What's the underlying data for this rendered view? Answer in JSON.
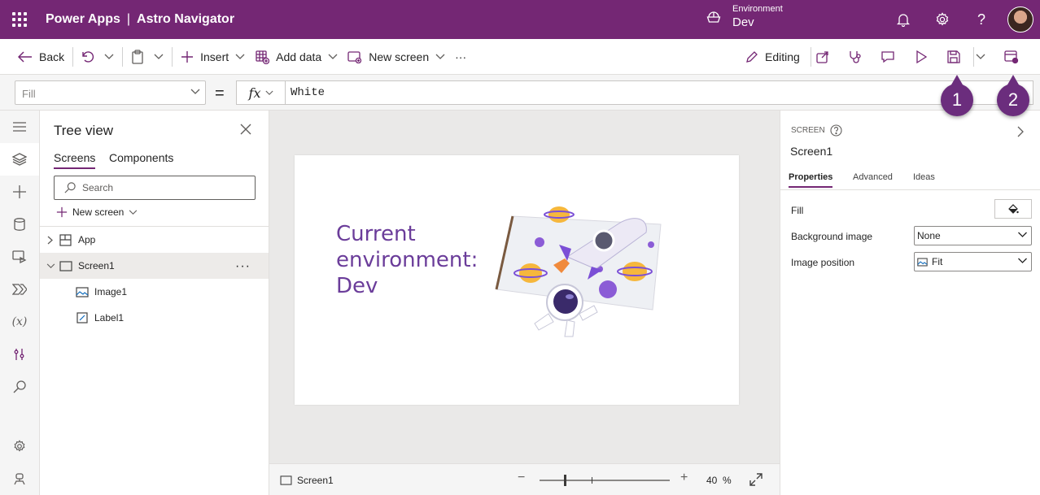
{
  "header": {
    "app_name": "Power Apps",
    "separator": "|",
    "project_name": "Astro Navigator",
    "environment_label": "Environment",
    "environment_value": "Dev",
    "icons": [
      "waffle-icon",
      "environment-icon",
      "bell-icon",
      "gear-icon",
      "help-icon",
      "avatar"
    ]
  },
  "command_bar": {
    "back": "Back",
    "insert": "Insert",
    "add_data": "Add data",
    "new_screen": "New screen",
    "more": "···",
    "editing": "Editing"
  },
  "formula_bar": {
    "property_placeholder": "Fill",
    "equals": "=",
    "fx": "fx",
    "formula": "White"
  },
  "tree_view": {
    "title": "Tree view",
    "tabs": [
      "Screens",
      "Components"
    ],
    "search_placeholder": "Search",
    "new_screen": "New screen",
    "nodes": [
      {
        "label": "App"
      },
      {
        "label": "Screen1"
      },
      {
        "label": "Image1"
      },
      {
        "label": "Label1"
      }
    ],
    "more": "···"
  },
  "canvas": {
    "label_text": [
      "Current",
      "environment:",
      "Dev"
    ],
    "label_color": "#6b3d9a"
  },
  "status_bar": {
    "screen_name": "Screen1",
    "zoom_value": "40",
    "zoom_unit": "%",
    "minus": "−",
    "plus": "+"
  },
  "properties": {
    "type": "SCREEN",
    "name": "Screen1",
    "tabs": [
      "Properties",
      "Advanced",
      "Ideas"
    ],
    "rows": [
      {
        "label": "Fill"
      },
      {
        "label": "Background image",
        "value": "None"
      },
      {
        "label": "Image position",
        "value": "Fit"
      }
    ]
  },
  "callouts": [
    "1",
    "2"
  ],
  "colors": {
    "brand": "#742774",
    "callout": "#6b2d7d"
  }
}
